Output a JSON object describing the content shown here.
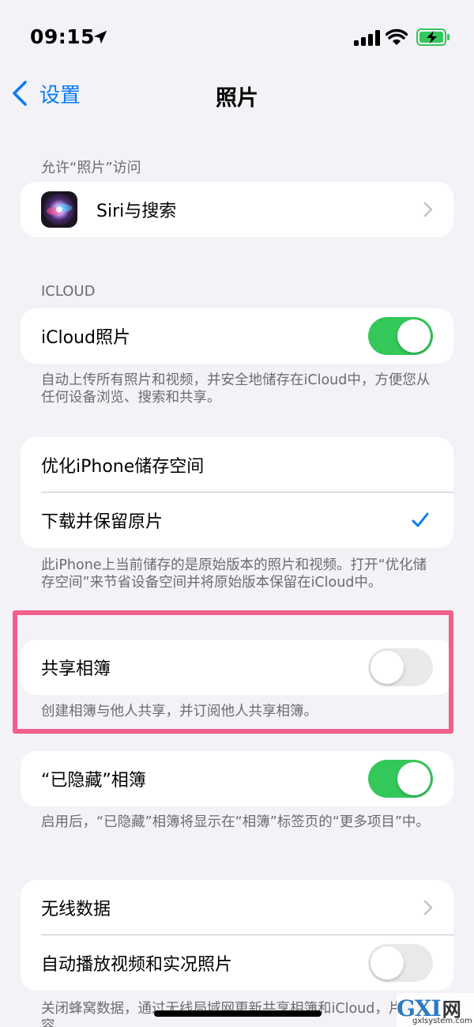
{
  "status_bar": {
    "time": "09:15"
  },
  "nav": {
    "back_label": "设置",
    "title": "照片"
  },
  "sections": {
    "access": {
      "header": "允许“照片”访问",
      "siri_label": "Siri与搜索"
    },
    "icloud": {
      "header": "ICLOUD",
      "icloud_photos_label": "iCloud照片",
      "icloud_photos_on": true,
      "footer": "自动上传所有照片和视频，并安全地储存在iCloud中，方便您从任何设备浏览、搜索和共享。"
    },
    "storage": {
      "optimize_label": "优化iPhone储存空间",
      "download_label": "下载并保留原片",
      "selected": "下载并保留原片",
      "footer": "此iPhone上当前储存的是原始版本的照片和视频。打开“优化储存空间”来节省设备空间并将原始版本保留在iCloud中。"
    },
    "shared": {
      "shared_albums_label": "共享相簿",
      "shared_albums_on": false,
      "footer": "创建相簿与他人共享，并订阅他人共享相簿。"
    },
    "hidden": {
      "hidden_album_label": "“已隐藏”相簿",
      "hidden_album_on": true,
      "footer": "启用后，“已隐藏”相簿将显示在“相簿”标签页的“更多项目”中。"
    },
    "data": {
      "wireless_label": "无线数据",
      "autoplay_label": "自动播放视频和实况照片",
      "autoplay_on": false,
      "footer": "关闭蜂窝数据，通过无线局域网更新共享相簿和iCloud，片等内容"
    }
  },
  "watermark": {
    "brand": "GXI",
    "suffix": "网",
    "domain": "gxlsystem.com"
  },
  "colors": {
    "accent": "#0a7cf5",
    "toggle_on": "#34c759",
    "highlight": "#f0608a",
    "background": "#f2f2f7"
  }
}
